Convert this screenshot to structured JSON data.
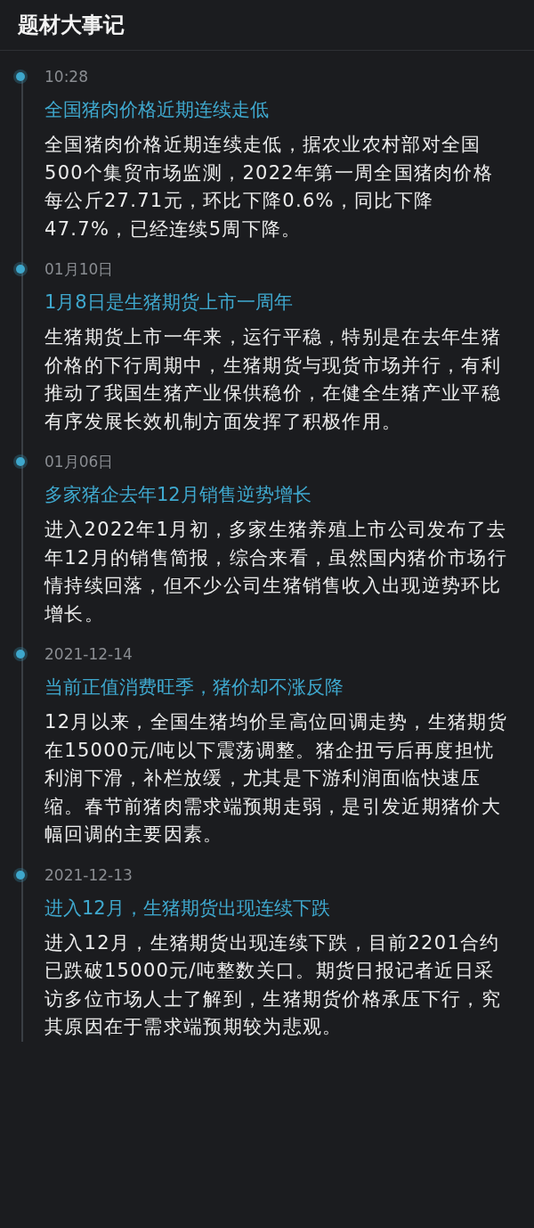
{
  "header": {
    "title": "题材大事记"
  },
  "events": [
    {
      "time": "10:28",
      "title": "全国猪肉价格近期连续走低",
      "body": "全国猪肉价格近期连续走低，据农业农村部对全国500个集贸市场监测，2022年第一周全国猪肉价格每公斤27.71元，环比下降0.6%，同比下降47.7%，已经连续5周下降。"
    },
    {
      "time": "01月10日",
      "title": "1月8日是生猪期货上市一周年",
      "body": "生猪期货上市一年来，运行平稳，特别是在去年生猪价格的下行周期中，生猪期货与现货市场并行，有利推动了我国生猪产业保供稳价，在健全生猪产业平稳有序发展长效机制方面发挥了积极作用。"
    },
    {
      "time": "01月06日",
      "title": "多家猪企去年12月销售逆势增长",
      "body": "进入2022年1月初，多家生猪养殖上市公司发布了去年12月的销售简报，综合来看，虽然国内猪价市场行情持续回落，但不少公司生猪销售收入出现逆势环比增长。"
    },
    {
      "time": "2021-12-14",
      "title": "当前正值消费旺季，猪价却不涨反降",
      "body": "12月以来，全国生猪均价呈高位回调走势，生猪期货在15000元/吨以下震荡调整。猪企扭亏后再度担忧利润下滑，补栏放缓，尤其是下游利润面临快速压缩。春节前猪肉需求端预期走弱，是引发近期猪价大幅回调的主要因素。"
    },
    {
      "time": "2021-12-13",
      "title": "进入12月，生猪期货出现连续下跌",
      "body": "进入12月，生猪期货出现连续下跌，目前2201合约已跌破15000元/吨整数关口。期货日报记者近日采访多位市场人士了解到，生猪期货价格承压下行，究其原因在于需求端预期较为悲观。"
    }
  ]
}
